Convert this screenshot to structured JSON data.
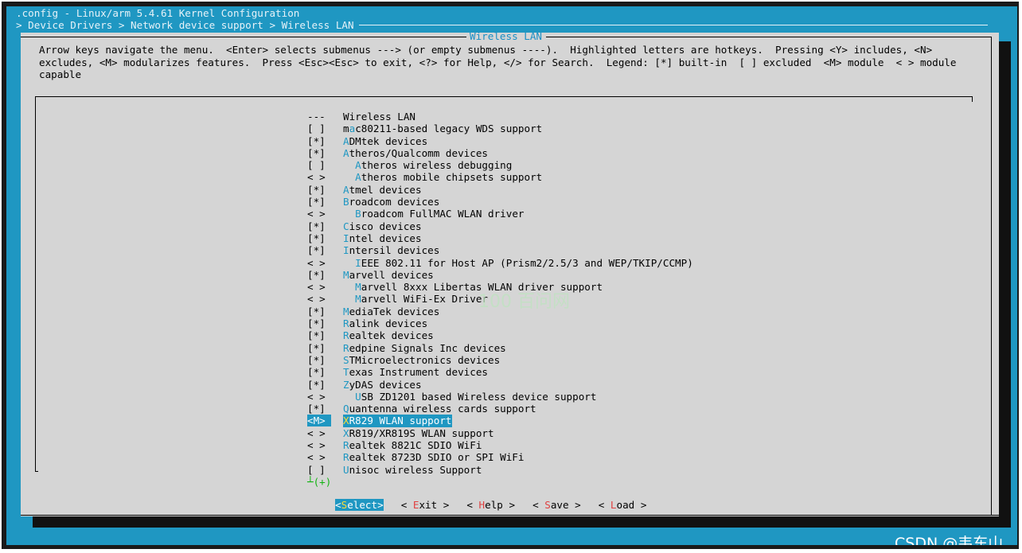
{
  "window": {
    "title": ".config - Linux/arm 5.4.61 Kernel Configuration",
    "breadcrumb": "> Device Drivers > Network device support > Wireless LAN"
  },
  "dialog": {
    "title": "Wireless LAN",
    "help_text": "Arrow keys navigate the menu.  <Enter> selects submenus ---> (or empty submenus ----).  Highlighted letters are hotkeys.  Pressing <Y> includes, <N>\nexcludes, <M> modularizes features.  Press <Esc><Esc> to exit, <?> for Help, </> for Search.  Legend: [*] built-in  [ ] excluded  <M> module  < > module\ncapable"
  },
  "menu": {
    "items": [
      {
        "mark": "---",
        "hot": "",
        "rest": "Wireless LAN",
        "indent": ""
      },
      {
        "mark": "[ ]",
        "pre": "m",
        "hot": "a",
        "rest": "c80211-based legacy WDS support",
        "indent": ""
      },
      {
        "mark": "[*]",
        "hot": "A",
        "rest": "DMtek devices",
        "indent": ""
      },
      {
        "mark": "[*]",
        "hot": "A",
        "rest": "theros/Qualcomm devices",
        "indent": ""
      },
      {
        "mark": "[ ]",
        "hot": "A",
        "rest": "theros wireless debugging",
        "indent": "  "
      },
      {
        "mark": "< >",
        "hot": "A",
        "rest": "theros mobile chipsets support",
        "indent": "  "
      },
      {
        "mark": "[*]",
        "hot": "A",
        "rest": "tmel devices",
        "indent": ""
      },
      {
        "mark": "[*]",
        "hot": "B",
        "rest": "roadcom devices",
        "indent": ""
      },
      {
        "mark": "< >",
        "hot": "B",
        "rest": "roadcom FullMAC WLAN driver",
        "indent": "  "
      },
      {
        "mark": "[*]",
        "hot": "C",
        "rest": "isco devices",
        "indent": ""
      },
      {
        "mark": "[*]",
        "hot": "I",
        "rest": "ntel devices",
        "indent": ""
      },
      {
        "mark": "[*]",
        "hot": "I",
        "rest": "ntersil devices",
        "indent": ""
      },
      {
        "mark": "< >",
        "hot": "I",
        "rest": "EEE 802.11 for Host AP (Prism2/2.5/3 and WEP/TKIP/CCMP)",
        "indent": "  "
      },
      {
        "mark": "[*]",
        "hot": "M",
        "rest": "arvell devices",
        "indent": ""
      },
      {
        "mark": "< >",
        "hot": "M",
        "rest": "arvell 8xxx Libertas WLAN driver support",
        "indent": "  "
      },
      {
        "mark": "< >",
        "hot": "M",
        "rest": "arvell WiFi-Ex Driver",
        "indent": "  "
      },
      {
        "mark": "[*]",
        "hot": "M",
        "rest": "ediaTek devices",
        "indent": ""
      },
      {
        "mark": "[*]",
        "hot": "R",
        "rest": "alink devices",
        "indent": ""
      },
      {
        "mark": "[*]",
        "hot": "R",
        "rest": "ealtek devices",
        "indent": ""
      },
      {
        "mark": "[*]",
        "hot": "R",
        "rest": "edpine Signals Inc devices",
        "indent": ""
      },
      {
        "mark": "[*]",
        "hot": "S",
        "rest": "TMicroelectronics devices",
        "indent": ""
      },
      {
        "mark": "[*]",
        "hot": "T",
        "rest": "exas Instrument devices",
        "indent": ""
      },
      {
        "mark": "[*]",
        "hot": "Z",
        "rest": "yDAS devices",
        "indent": ""
      },
      {
        "mark": "< >",
        "hot": "U",
        "rest": "SB ZD1201 based Wireless device support",
        "indent": "  "
      },
      {
        "mark": "[*]",
        "hot": "Q",
        "rest": "uantenna wireless cards support",
        "indent": ""
      },
      {
        "mark": "<M>",
        "hot": "X",
        "rest": "R829 WLAN support",
        "indent": "",
        "selected": true
      },
      {
        "mark": "< >",
        "hot": "X",
        "rest": "R819/XR819S WLAN support",
        "indent": ""
      },
      {
        "mark": "< >",
        "hot": "R",
        "rest": "ealtek 8821C SDIO WiFi",
        "indent": ""
      },
      {
        "mark": "< >",
        "hot": "R",
        "rest": "ealtek 8723D SDIO or SPI WiFi",
        "indent": ""
      },
      {
        "mark": "[ ]",
        "hot": "U",
        "rest": "nisoc wireless Support",
        "indent": ""
      }
    ],
    "more_indicator": "┴(+)"
  },
  "buttons": [
    {
      "pre": "<",
      "hot": "S",
      "rest": "elect",
      "post": ">",
      "active": true
    },
    {
      "pre": "< ",
      "hot": "E",
      "rest": "xit",
      "post": " >"
    },
    {
      "pre": "< ",
      "hot": "H",
      "rest": "elp",
      "post": " >"
    },
    {
      "pre": "< ",
      "hot": "S",
      "rest": "ave",
      "post": " >"
    },
    {
      "pre": "< ",
      "hot": "L",
      "rest": "oad",
      "post": " >"
    }
  ],
  "watermark": "100 百问网",
  "credit": "CSDN @韦东山",
  "colors": {
    "terminal_bg": "#1f97c2",
    "dialog_bg": "#d5d5d5",
    "hotkey": "#1f97c2",
    "button_hotkey": "#e04040",
    "more": "#12b312"
  }
}
